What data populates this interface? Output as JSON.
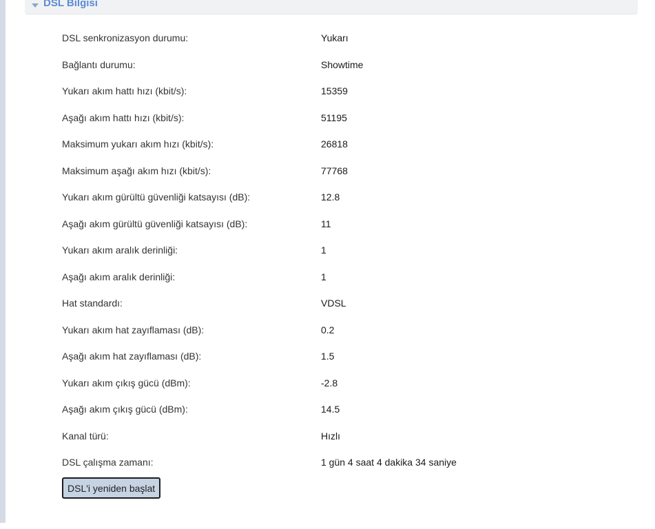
{
  "panel": {
    "title": "DSL Bilgisi"
  },
  "rows": [
    {
      "label": "DSL senkronizasyon durumu:",
      "value": "Yukarı"
    },
    {
      "label": "Bağlantı durumu:",
      "value": "Showtime"
    },
    {
      "label": "Yukarı akım hattı hızı (kbit/s):",
      "value": "15359"
    },
    {
      "label": "Aşağı akım hattı hızı (kbit/s):",
      "value": "51195"
    },
    {
      "label": "Maksimum yukarı akım hızı (kbit/s):",
      "value": "26818"
    },
    {
      "label": "Maksimum aşağı akım hızı (kbit/s):",
      "value": "77768"
    },
    {
      "label": "Yukarı akım gürültü güvenliği katsayısı (dB):",
      "value": "12.8"
    },
    {
      "label": "Aşağı akım gürültü güvenliği katsayısı (dB):",
      "value": "11"
    },
    {
      "label": "Yukarı akım aralık derinliği:",
      "value": "1"
    },
    {
      "label": "Aşağı akım aralık derinliği:",
      "value": "1"
    },
    {
      "label": "Hat standardı:",
      "value": "VDSL"
    },
    {
      "label": "Yukarı akım hat zayıflaması (dB):",
      "value": "0.2"
    },
    {
      "label": "Aşağı akım hat zayıflaması (dB):",
      "value": "1.5"
    },
    {
      "label": "Yukarı akım çıkış gücü (dBm):",
      "value": "-2.8"
    },
    {
      "label": "Aşağı akım çıkış gücü (dBm):",
      "value": "14.5"
    },
    {
      "label": "Kanal türü:",
      "value": "Hızlı"
    },
    {
      "label": "DSL çalışma zamanı:",
      "value": "1 gün 4 saat 4 dakika 34 saniye"
    }
  ],
  "actions": {
    "restart_label": "DSL'i yeniden başlat"
  },
  "icons": {
    "collapse": "caret-down-icon"
  },
  "colors": {
    "title": "#5b8ad6",
    "button_bg": "#c5d3e3"
  }
}
